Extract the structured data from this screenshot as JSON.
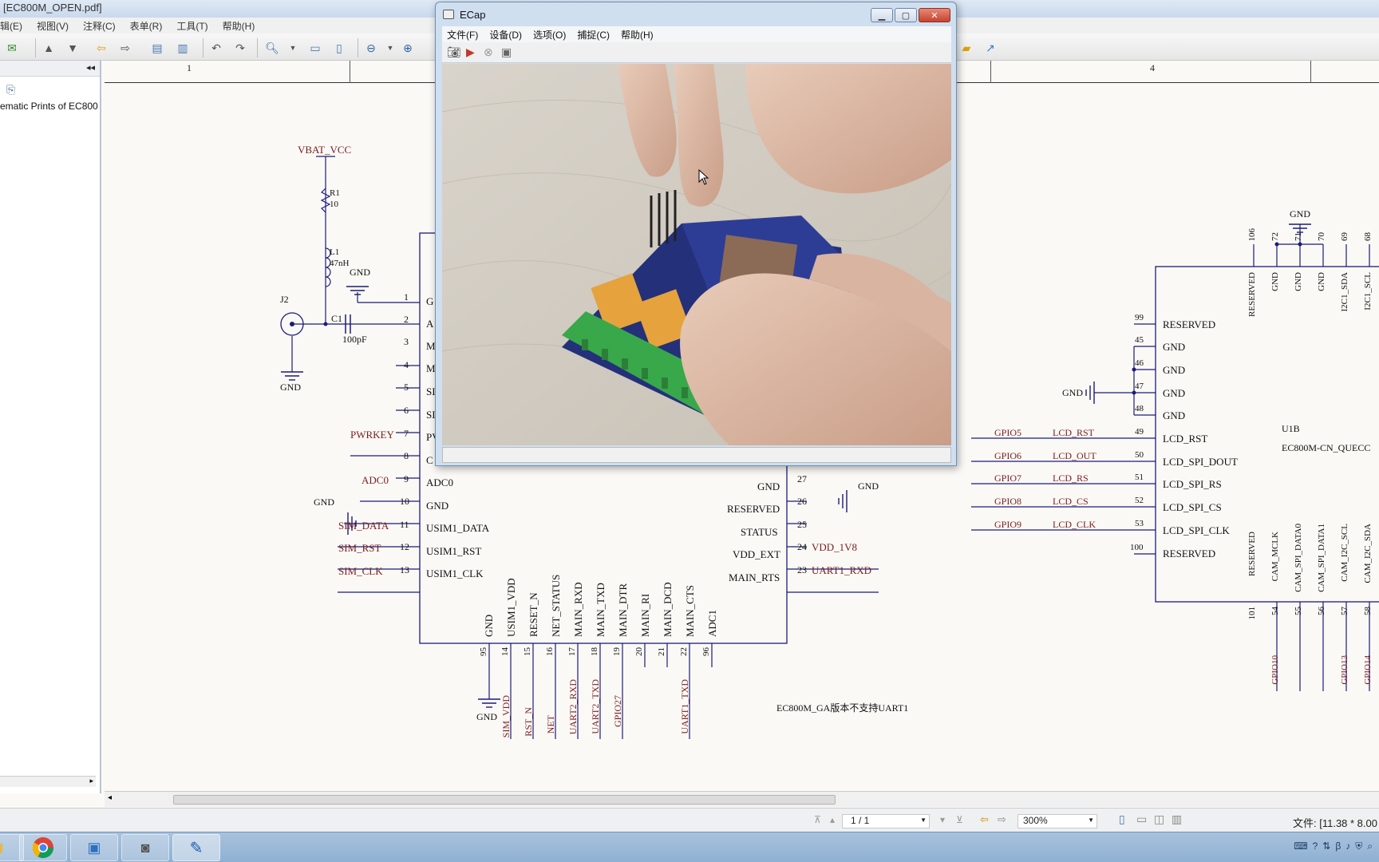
{
  "pdf_viewer": {
    "title": "[EC800M_OPEN.pdf]",
    "menu": [
      "辑(E)",
      "视图(V)",
      "注释(C)",
      "表单(R)",
      "工具(T)",
      "帮助(H)"
    ],
    "sidebar_item": "ematic Prints of EC800",
    "ruler": {
      "col1": "1",
      "col4": "4"
    },
    "page": "1 / 1",
    "zoom": "300%",
    "file_info": "文件: [11.38 * 8.00"
  },
  "schematic": {
    "left_labels": {
      "vbat": "VBAT_VCC",
      "r1": "R1",
      "r1_val": "10",
      "l1": "L1",
      "l1_val": "47nH",
      "gnd": "GND",
      "j2": "J2",
      "c1": "C1",
      "c1_val": "100pF",
      "pwrkey": "PWRKEY",
      "adc0": "ADC0",
      "sim_data": "SIM_DATA",
      "sim_rst": "SIM_RST",
      "sim_clk": "SIM_CLK"
    },
    "left_pins": [
      "1",
      "2",
      "3",
      "4",
      "5",
      "6",
      "7",
      "8",
      "9",
      "10",
      "11",
      "12",
      "13"
    ],
    "left_pin_names": [
      "G",
      "A",
      "M",
      "M",
      "SI",
      "SI",
      "PV",
      "C",
      "ADC0",
      "GND",
      "USIM1_DATA",
      "USIM1_RST",
      "USIM1_CLK"
    ],
    "right_pin_names": [
      "GND",
      "RESERVED",
      "STATUS",
      "VDD_EXT",
      "MAIN_RTS"
    ],
    "right_pin_nums": [
      "27",
      "26",
      "25",
      "24",
      "23"
    ],
    "right_nets": [
      "GND",
      "",
      "",
      "VDD_1V8",
      "UART1_RXD"
    ],
    "bottom_pin_names": [
      "GND",
      "USIM1_VDD",
      "RESET_N",
      "NET_STATUS",
      "MAIN_RXD",
      "MAIN_TXD",
      "MAIN_DTR",
      "MAIN_RI",
      "MAIN_DCD",
      "MAIN_CTS",
      "ADC1"
    ],
    "bottom_pin_nums": [
      "95",
      "14",
      "15",
      "16",
      "17",
      "18",
      "19",
      "20",
      "21",
      "22",
      "96"
    ],
    "bottom_nets": [
      "GND",
      "SIM_VDD",
      "RST_N",
      "NET",
      "UART2_RXD",
      "UART2_TXD",
      "GPIO27",
      "",
      "",
      "UART1_TXD",
      ""
    ],
    "note": "EC800M_GA版本不支持UART1",
    "u1b": {
      "ref": "U1B",
      "part": "EC800M-CN_QUECC",
      "gnd_top": "GND",
      "gnd_left": "GND",
      "top_pin_nums": [
        "106",
        "72",
        "71",
        "70",
        "69",
        "68"
      ],
      "top_pin_names": [
        "RESERVED",
        "GND",
        "GND",
        "GND",
        "I2C1_SDA",
        "I2C1_SCL"
      ],
      "left_pin_nums": [
        "99",
        "45",
        "46",
        "47",
        "48",
        "49",
        "50",
        "51",
        "52",
        "53",
        "100"
      ],
      "left_pin_names": [
        "RESERVED",
        "GND",
        "GND",
        "GND",
        "GND",
        "LCD_RST",
        "LCD_SPI_DOUT",
        "LCD_SPI_RS",
        "LCD_SPI_CS",
        "LCD_SPI_CLK",
        "RESERVED"
      ],
      "gpio_nets": [
        "GPIO5",
        "GPIO6",
        "GPIO7",
        "GPIO8",
        "GPIO9"
      ],
      "lcd_nets": [
        "LCD_RST",
        "LCD_OUT",
        "LCD_RS",
        "LCD_CS",
        "LCD_CLK"
      ],
      "bottom_pin_names": [
        "RESERVED",
        "CAM_MCLK",
        "CAM_SPI_DATA0",
        "CAM_SPI_DATA1",
        "CAM_I2C_SCL",
        "CAM_I2C_SDA"
      ],
      "bottom_pin_nums": [
        "101",
        "54",
        "55",
        "56",
        "57",
        "58"
      ],
      "bottom_nets": [
        "",
        "GPIO10",
        "",
        "",
        "GPIO13",
        "GPIO14"
      ]
    }
  },
  "ecap": {
    "title": "ECap",
    "menu": [
      "文件(F)",
      "设备(D)",
      "选项(O)",
      "捕捉(C)",
      "帮助(H)"
    ],
    "tools": [
      "camera-icon",
      "play-icon",
      "stop-icon",
      "image-icon"
    ]
  },
  "taskbar": {
    "apps": [
      "file-explorer-icon",
      "chrome-icon",
      "app-icon",
      "camera-app-icon",
      "pdf-app-icon"
    ]
  }
}
